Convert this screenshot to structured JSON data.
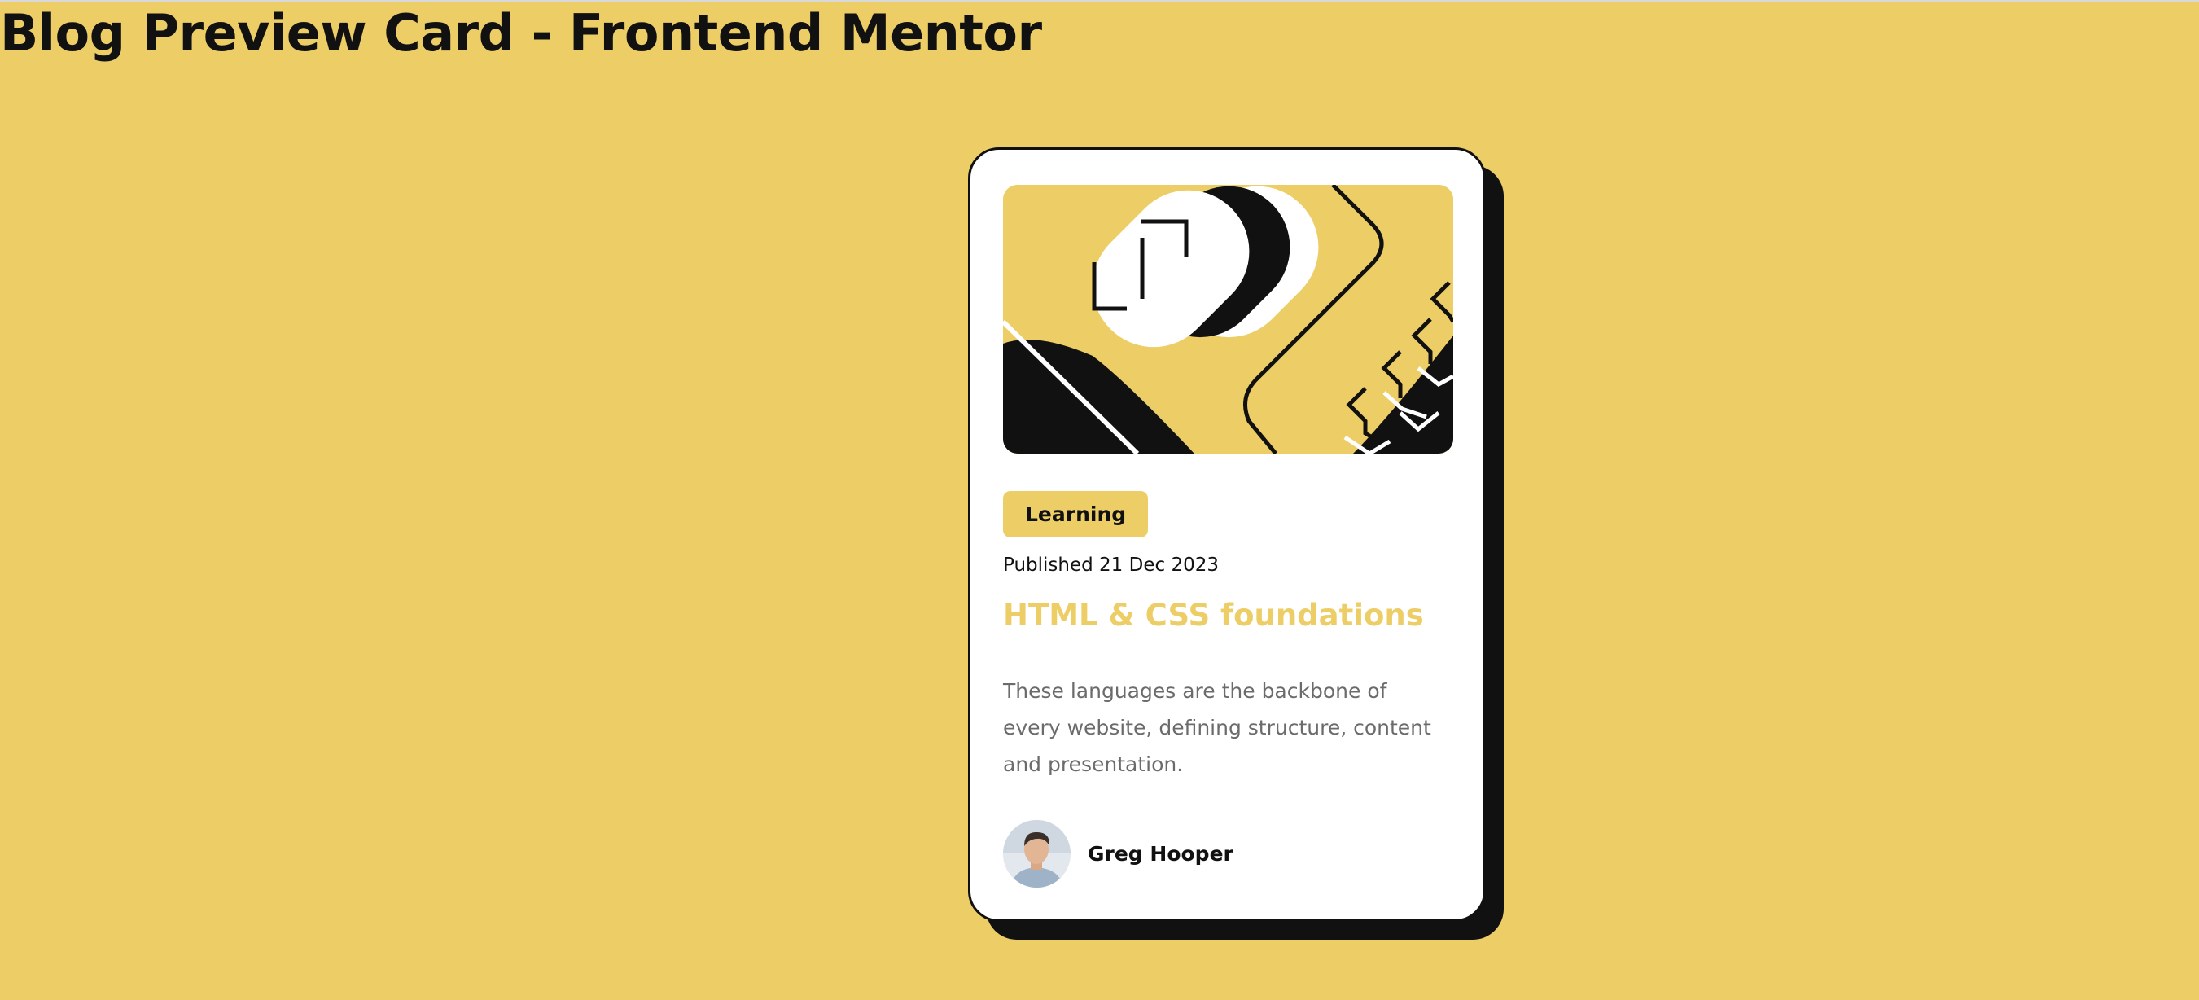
{
  "page": {
    "title": "Blog Preview Card - Frontend Mentor"
  },
  "card": {
    "hero_image": "illustration-article",
    "tag": "Learning",
    "published": "Published 21 Dec 2023",
    "title": "HTML & CSS foundations",
    "excerpt": "These languages are the backbone of every website, defining structure, content and presentation.",
    "author": {
      "name": "Greg Hooper",
      "avatar": "greg-hooper-avatar"
    }
  },
  "colors": {
    "background": "#EDCE66",
    "card": "#FFFFFF",
    "ink": "#111111",
    "muted": "#6B6B6B",
    "accent": "#EDCE66"
  }
}
